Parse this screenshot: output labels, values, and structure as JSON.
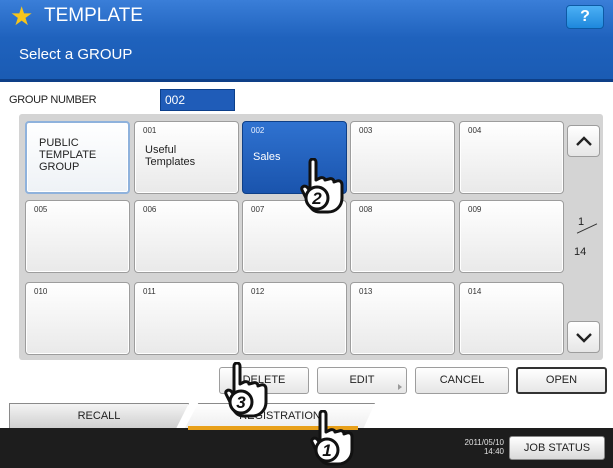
{
  "header": {
    "title": "TEMPLATE",
    "help_label": "?",
    "subtitle": "Select a GROUP"
  },
  "group_number": {
    "label": "GROUP NUMBER",
    "value": "002"
  },
  "grid": {
    "cells": [
      {
        "num": "",
        "name": "PUBLIC\nTEMPLATE\nGROUP"
      },
      {
        "num": "001",
        "name": "Useful\nTemplates"
      },
      {
        "num": "002",
        "name": "Sales"
      },
      {
        "num": "003",
        "name": ""
      },
      {
        "num": "004",
        "name": ""
      },
      {
        "num": "005",
        "name": ""
      },
      {
        "num": "006",
        "name": ""
      },
      {
        "num": "007",
        "name": ""
      },
      {
        "num": "008",
        "name": ""
      },
      {
        "num": "009",
        "name": ""
      },
      {
        "num": "010",
        "name": ""
      },
      {
        "num": "011",
        "name": ""
      },
      {
        "num": "012",
        "name": ""
      },
      {
        "num": "013",
        "name": ""
      },
      {
        "num": "014",
        "name": ""
      }
    ],
    "selected_num": "002"
  },
  "pager": {
    "current": "1",
    "total": "14",
    "up_icon": "chevron-up-icon",
    "down_icon": "chevron-down-icon"
  },
  "actions": {
    "delete": "DELETE",
    "edit": "EDIT",
    "cancel": "CANCEL",
    "open": "OPEN"
  },
  "tabs": {
    "recall": "RECALL",
    "registration": "REGISTRATION"
  },
  "status": {
    "date": "2011/05/10",
    "time": "14:40",
    "job_status": "JOB STATUS"
  },
  "callouts": [
    "1",
    "2",
    "3"
  ],
  "colors": {
    "header_blue": "#1f62bd",
    "selected_blue": "#1a54ad",
    "star_yellow": "#f7c51b",
    "tab_accent": "#e8a019",
    "statusbar": "#1d1d1d"
  }
}
